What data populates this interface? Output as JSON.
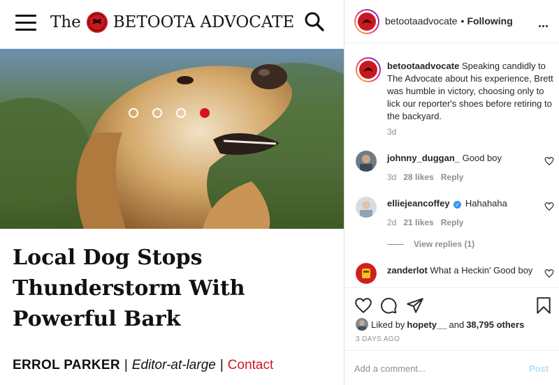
{
  "article": {
    "brand_the": "The",
    "brand_name": "BETOOTA ADVOCATE",
    "headline": "Local Dog Stops Thunderstorm With Powerful Bark",
    "author": "ERROL PARKER",
    "separator": "|",
    "role": "Editor-at-large",
    "contact": "Contact",
    "carousel": {
      "slides": 4,
      "active_index": 3
    }
  },
  "post": {
    "header": {
      "username": "betootaadvocate",
      "bullet": "•",
      "follow_label": "Following"
    },
    "caption": {
      "username": "betootaadvocate",
      "text": "Speaking candidly to The Advocate about his experience, Brett was humble in victory, choosing only to lick our reporter's shoes before retiring to the backyard.",
      "age": "3d"
    },
    "comments": [
      {
        "username": "johnny_duggan_",
        "text": "Good boy",
        "age": "3d",
        "likes": "28 likes",
        "reply": "Reply"
      },
      {
        "username": "elliejeancoffey",
        "verified": true,
        "text": "Hahahaha",
        "age": "2d",
        "likes": "21 likes",
        "reply": "Reply",
        "view_replies": "View replies (1)"
      },
      {
        "username": "zanderlot",
        "text": "What a Heckin' Good boy"
      }
    ],
    "liked_by_prefix": "Liked by",
    "liked_by_user": "hopety__",
    "liked_by_and": "and",
    "liked_by_count": "38,795 others",
    "date": "3 DAYS AGO",
    "add_comment_placeholder": "Add a comment...",
    "post_label": "Post"
  },
  "colors": {
    "brand_red": "#d3161b",
    "ig_blue": "#3897f0",
    "post_disabled": "#b2dffc",
    "meta_gray": "#8e8e8e"
  }
}
